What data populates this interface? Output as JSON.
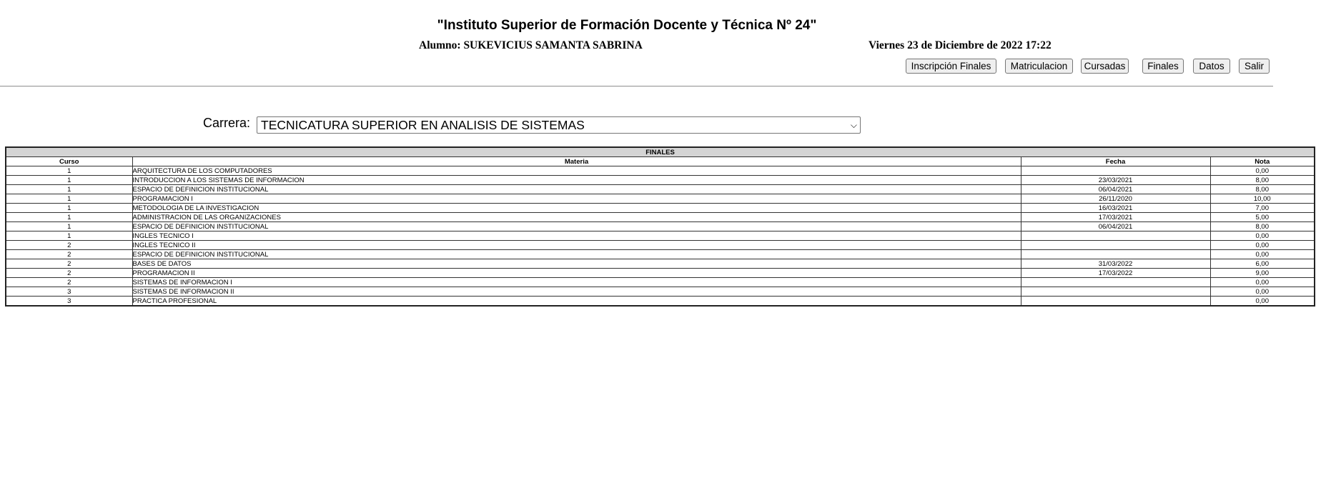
{
  "header": {
    "institute": "\"Instituto Superior de Formación Docente y Técnica Nº 24\"",
    "student": "Alumno: SUKEVICIUS SAMANTA SABRINA",
    "datetime": "Viernes 23 de Diciembre de 2022 17:22"
  },
  "nav": {
    "inscripcion": "Inscripción Finales",
    "matriculacion": "Matriculacion",
    "cursadas": "Cursadas",
    "finales": "Finales",
    "datos": "Datos",
    "salir": "Salir"
  },
  "career": {
    "label": "Carrera:",
    "selected": "TECNICATURA SUPERIOR EN ANALISIS DE SISTEMAS"
  },
  "table": {
    "caption": "FINALES",
    "columns": [
      "Curso",
      "Materia",
      "Fecha",
      "Nota"
    ],
    "rows": [
      {
        "curso": "1",
        "materia": "ARQUITECTURA DE LOS COMPUTADORES",
        "fecha": "",
        "nota": "0,00"
      },
      {
        "curso": "1",
        "materia": "INTRODUCCION A LOS SISTEMAS DE INFORMACION",
        "fecha": "23/03/2021",
        "nota": "8,00"
      },
      {
        "curso": "1",
        "materia": "ESPACIO DE DEFINICION INSTITUCIONAL",
        "fecha": "06/04/2021",
        "nota": "8,00"
      },
      {
        "curso": "1",
        "materia": "PROGRAMACION I",
        "fecha": "26/11/2020",
        "nota": "10,00"
      },
      {
        "curso": "1",
        "materia": "METODOLOGIA DE LA INVESTIGACION",
        "fecha": "16/03/2021",
        "nota": "7,00"
      },
      {
        "curso": "1",
        "materia": "ADMINISTRACION DE LAS ORGANIZACIONES",
        "fecha": "17/03/2021",
        "nota": "5,00"
      },
      {
        "curso": "1",
        "materia": "ESPACIO DE DEFINICION INSTITUCIONAL",
        "fecha": "06/04/2021",
        "nota": "8,00"
      },
      {
        "curso": "1",
        "materia": "INGLES TECNICO I",
        "fecha": "",
        "nota": "0,00"
      },
      {
        "curso": "2",
        "materia": "INGLES TECNICO II",
        "fecha": "",
        "nota": "0,00"
      },
      {
        "curso": "2",
        "materia": "ESPACIO DE DEFINICION INSTITUCIONAL",
        "fecha": "",
        "nota": "0,00"
      },
      {
        "curso": "2",
        "materia": "BASES DE DATOS",
        "fecha": "31/03/2022",
        "nota": "6,00"
      },
      {
        "curso": "2",
        "materia": "PROGRAMACION II",
        "fecha": "17/03/2022",
        "nota": "9,00"
      },
      {
        "curso": "2",
        "materia": "SISTEMAS DE INFORMACION I",
        "fecha": "",
        "nota": "0,00"
      },
      {
        "curso": "3",
        "materia": "SISTEMAS DE INFORMACION II",
        "fecha": "",
        "nota": "0,00"
      },
      {
        "curso": "3",
        "materia": "PRACTICA PROFESIONAL",
        "fecha": "",
        "nota": "0,00"
      }
    ]
  }
}
